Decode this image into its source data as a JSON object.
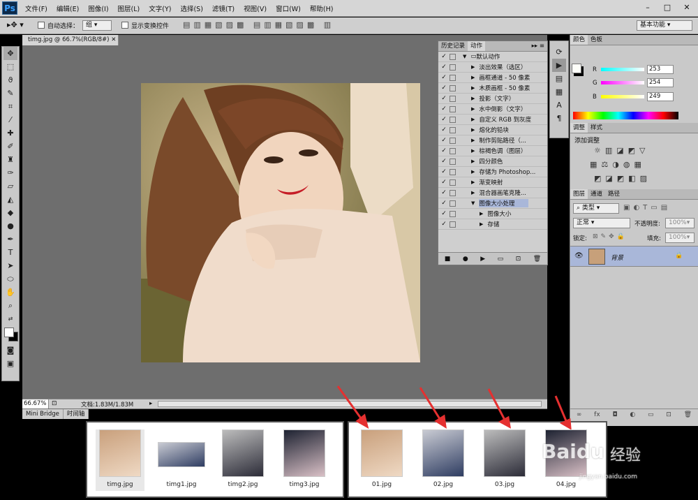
{
  "app": {
    "logo": "Ps"
  },
  "menus": [
    "文件(F)",
    "编辑(E)",
    "图像(I)",
    "图层(L)",
    "文字(Y)",
    "选择(S)",
    "滤镜(T)",
    "视图(V)",
    "窗口(W)",
    "帮助(H)"
  ],
  "options": {
    "auto_select": "自动选择：",
    "group": "组",
    "show_transform": "显示变换控件",
    "workspace": "基本功能"
  },
  "document": {
    "tab": "timg.jpg @ 66.7%(RGB/8#)",
    "zoom": "66.67%",
    "docinfo": "文档:1.83M/1.83M"
  },
  "bottom_tabs": [
    "Mini Bridge",
    "时间轴"
  ],
  "actions_panel": {
    "tabs": [
      "历史记录",
      "动作"
    ],
    "rows": [
      {
        "label": "默认动作",
        "level": 0,
        "folder": true
      },
      {
        "label": "淡出效果（选区）",
        "level": 1
      },
      {
        "label": "画框通道 - 50 像素",
        "level": 1
      },
      {
        "label": "木质画框 - 50 像素",
        "level": 1
      },
      {
        "label": "投影（文字）",
        "level": 1
      },
      {
        "label": "水中倒影（文字）",
        "level": 1
      },
      {
        "label": "自定义 RGB 到灰度",
        "level": 1
      },
      {
        "label": "熔化的铅块",
        "level": 1
      },
      {
        "label": "制作剪贴路径（...",
        "level": 1
      },
      {
        "label": "棕褐色调（图层）",
        "level": 1
      },
      {
        "label": "四分颜色",
        "level": 1
      },
      {
        "label": "存储为 Photoshop...",
        "level": 1
      },
      {
        "label": "渐变映射",
        "level": 1
      },
      {
        "label": "混合器画笔克隆...",
        "level": 1
      },
      {
        "label": "图像大小处理",
        "level": 1,
        "selected": true
      },
      {
        "label": "图像大小",
        "level": 2
      },
      {
        "label": "存储",
        "level": 2
      }
    ]
  },
  "color_panel": {
    "tabs": [
      "颜色",
      "色板"
    ],
    "r_label": "R",
    "g_label": "G",
    "b_label": "B",
    "r": "253",
    "g": "254",
    "b": "249"
  },
  "adjust_panel": {
    "tabs": [
      "调整",
      "样式"
    ],
    "title": "添加调整"
  },
  "layers_panel": {
    "tabs": [
      "图层",
      "通道",
      "路径"
    ],
    "kind": "类型",
    "blend": "正常",
    "opacity_label": "不透明度:",
    "opacity": "100%",
    "lock_label": "锁定:",
    "fill_label": "填充:",
    "fill": "100%",
    "layer_name": "背景"
  },
  "explorer_left": [
    "timg.jpg",
    "timg1.jpg",
    "timg2.jpg",
    "timg3.jpg"
  ],
  "explorer_right": [
    "01.jpg",
    "02.jpg",
    "03.jpg",
    "04.jpg"
  ],
  "watermark": {
    "brand": "Baidu",
    "sub": "经验",
    "url": "jingyan.baidu.com"
  },
  "colors": {
    "accent": "#e53030",
    "panel": "#cfcfcf",
    "canvas": "#6e6e6e"
  }
}
